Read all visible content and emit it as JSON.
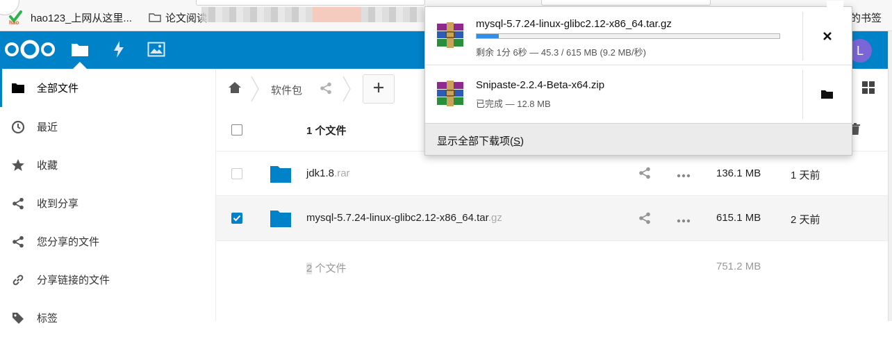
{
  "browser": {
    "bookmarks": [
      {
        "label": "hao123_上网从这里..."
      },
      {
        "label": "论文阅读"
      }
    ],
    "bookmarks_right_label": "的书签"
  },
  "nextcloud": {
    "avatar_letter": "L",
    "colors": {
      "brand": "#0082c9",
      "avatar": "#7b66d6"
    },
    "sidebar": {
      "items": [
        {
          "label": "全部文件",
          "icon": "folder-icon",
          "active": true
        },
        {
          "label": "最近",
          "icon": "clock-icon"
        },
        {
          "label": "收藏",
          "icon": "star-icon"
        },
        {
          "label": "收到分享",
          "icon": "share-icon"
        },
        {
          "label": "您分享的文件",
          "icon": "share-icon"
        },
        {
          "label": "分享链接的文件",
          "icon": "link-icon"
        },
        {
          "label": "标签",
          "icon": "tag-icon"
        }
      ]
    },
    "breadcrumb": {
      "current": "软件包"
    },
    "file_list": {
      "selected_count_label": "1 个文件",
      "rows": [
        {
          "name": "jdk1.8",
          "ext": ".rar",
          "size": "136.1 MB",
          "date": "1 天前",
          "checked": false
        },
        {
          "name": "mysql-5.7.24-linux-glibc2.12-x86_64.tar",
          "ext": ".gz",
          "size": "615.1 MB",
          "date": "2 天前",
          "checked": true
        }
      ],
      "summary_count": "2",
      "summary_label": " 个文件",
      "summary_size": "751.2 MB"
    }
  },
  "downloads": {
    "items": [
      {
        "name": "mysql-5.7.24-linux-glibc2.12-x86_64.tar.gz",
        "status": "剩余 1分 6秒 — 45.3 / 615 MB (9.2 MB/秒)",
        "progress_percent": 7.4,
        "action": "close-icon"
      },
      {
        "name": "Snipaste-2.2.4-Beta-x64.zip",
        "status": "已完成 — 12.8 MB",
        "action": "open-folder-icon"
      }
    ],
    "show_all_label": "显示全部下载项(",
    "show_all_key": "S",
    "show_all_suffix": ")"
  }
}
